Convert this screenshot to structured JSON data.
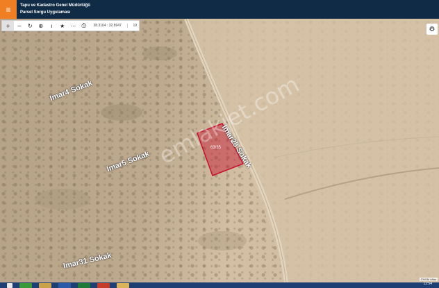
{
  "header": {
    "title_line1": "Tapu ve Kadastro Genel Müdürlüğü",
    "title_line2": "Parsel Sorgu Uygulaması",
    "menu_icon": "hamburger-menu-icon"
  },
  "toolbar": {
    "coords": "38.3164 : 32.8947",
    "zoom": "19",
    "tools": [
      "zoom-in-icon",
      "zoom-out-icon",
      "refresh-icon",
      "locate-icon",
      "info-icon",
      "favorite-icon",
      "measure-icon",
      "print-icon"
    ]
  },
  "map": {
    "streets": [
      "Imar4 Sokak",
      "Imar5 Sokak",
      "Imar28 Sokak",
      "Imar31 Sokak"
    ],
    "parcel_label": "63/35",
    "watermark": "emlakjet.com",
    "attribution": "©HGM Atlas",
    "parcel_color": "#c8102e"
  },
  "taskbar": {
    "clock": "12:54",
    "apps": [
      "windows-start-icon",
      "chrome-icon",
      "explorer-icon",
      "word-icon",
      "excel-icon",
      "powerpoint-icon",
      "folder-icon"
    ]
  },
  "colors": {
    "header_bg": "#0f2b45",
    "menu_accent": "#f07f24",
    "taskbar_bg": "#1e3f73"
  }
}
